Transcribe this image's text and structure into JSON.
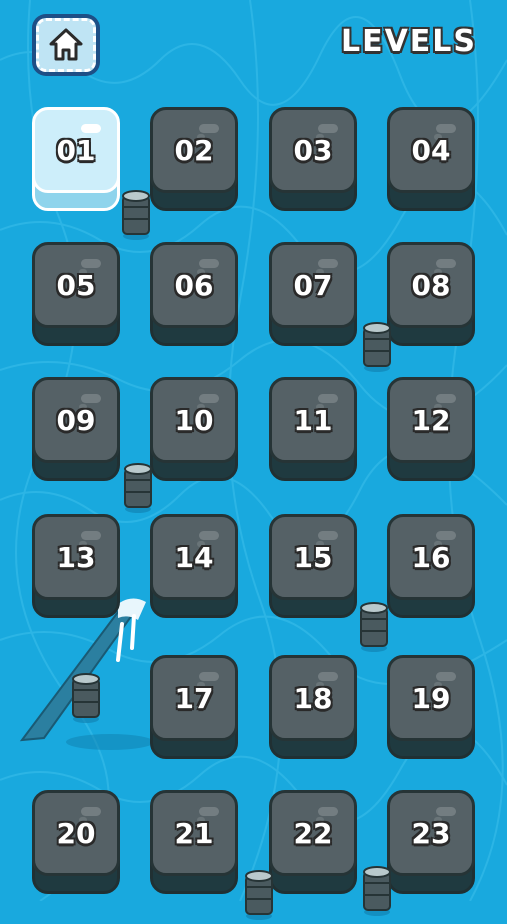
{
  "header": {
    "title": "LEVELS",
    "home_icon": "home-icon"
  },
  "levels": [
    {
      "label": "01",
      "state": "active"
    },
    {
      "label": "02",
      "state": "locked"
    },
    {
      "label": "03",
      "state": "locked"
    },
    {
      "label": "04",
      "state": "locked"
    },
    {
      "label": "05",
      "state": "locked"
    },
    {
      "label": "06",
      "state": "locked"
    },
    {
      "label": "07",
      "state": "locked"
    },
    {
      "label": "08",
      "state": "locked"
    },
    {
      "label": "09",
      "state": "locked"
    },
    {
      "label": "10",
      "state": "locked"
    },
    {
      "label": "11",
      "state": "locked"
    },
    {
      "label": "12",
      "state": "locked"
    },
    {
      "label": "13",
      "state": "locked"
    },
    {
      "label": "14",
      "state": "locked"
    },
    {
      "label": "15",
      "state": "locked"
    },
    {
      "label": "16",
      "state": "locked"
    },
    {
      "label": "17",
      "state": "locked"
    },
    {
      "label": "18",
      "state": "locked"
    },
    {
      "label": "19",
      "state": "locked"
    },
    {
      "label": "20",
      "state": "locked"
    },
    {
      "label": "21",
      "state": "locked"
    },
    {
      "label": "22",
      "state": "locked"
    },
    {
      "label": "23",
      "state": "locked"
    }
  ],
  "colors": {
    "water": "#19a9de",
    "tile_face": "#556166",
    "tile_active": "#cdeefa",
    "home_button": "#1d4f86"
  }
}
